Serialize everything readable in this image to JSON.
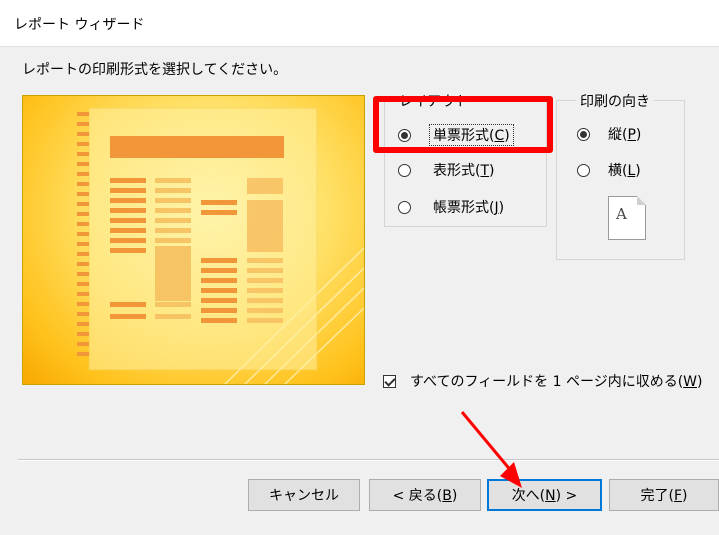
{
  "window": {
    "title": "レポート ウィザード"
  },
  "instruction": "レポートの印刷形式を選択してください。",
  "layout_group": {
    "legend": "レイアウト",
    "options": [
      {
        "label": "単票形式(",
        "key": "C",
        "suffix": ")",
        "checked": true
      },
      {
        "label": "表形式(",
        "key": "T",
        "suffix": ")",
        "checked": false
      },
      {
        "label": "帳票形式(",
        "key": "J",
        "suffix": ")",
        "checked": false
      }
    ]
  },
  "orientation_group": {
    "legend": "印刷の向き",
    "options": [
      {
        "label": "縦(",
        "key": "P",
        "suffix": ")",
        "checked": true
      },
      {
        "label": "横(",
        "key": "L",
        "suffix": ")",
        "checked": false
      }
    ],
    "page_icon_letter": "A"
  },
  "fit_checkbox": {
    "label": "すべてのフィールドを 1 ページ内に収める(",
    "key": "W",
    "suffix": ")",
    "checked": true
  },
  "buttons": {
    "cancel": "キャンセル",
    "back": {
      "label": "< 戻る(",
      "key": "B",
      "suffix": ")"
    },
    "next": {
      "label": "次へ(",
      "key": "N",
      "suffix": ") >"
    },
    "finish": {
      "label": "完了(",
      "key": "F",
      "suffix": ")"
    }
  },
  "colors": {
    "highlight": "#ff0000",
    "default_button_border": "#0078d7",
    "preview_bar": "#f2963a"
  }
}
